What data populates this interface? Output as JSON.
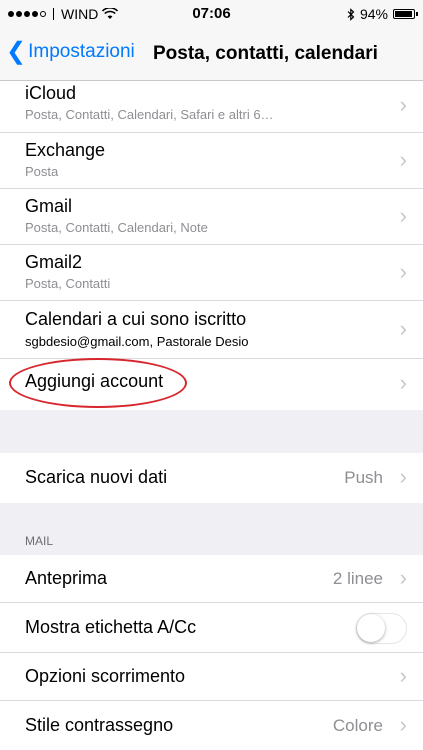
{
  "status_bar": {
    "carrier": "WIND",
    "time": "07:06",
    "battery_percent": "94%",
    "battery_level": 0.94
  },
  "nav": {
    "back_label": "Impostazioni",
    "title": "Posta, contatti, calendari"
  },
  "accounts": [
    {
      "title": "iCloud",
      "subtitle": "Posta, Contatti, Calendari, Safari e altri 6…"
    },
    {
      "title": "Exchange",
      "subtitle": "Posta"
    },
    {
      "title": "Gmail",
      "subtitle": "Posta, Contatti, Calendari, Note"
    },
    {
      "title": "Gmail2",
      "subtitle": "Posta, Contatti"
    },
    {
      "title": "Calendari a cui sono iscritto",
      "subtitle": "sgbdesio@gmail.com, Pastorale Desio"
    }
  ],
  "add_account": {
    "label": "Aggiungi account"
  },
  "fetch": {
    "label": "Scarica nuovi dati",
    "value": "Push"
  },
  "mail_section": {
    "header": "MAIL",
    "preview": {
      "label": "Anteprima",
      "value": "2 linee"
    },
    "show_to_cc": {
      "label": "Mostra etichetta A/Cc",
      "on": false
    },
    "swipe_options": {
      "label": "Opzioni scorrimento"
    },
    "flag_style": {
      "label": "Stile contrassegno",
      "value": "Colore"
    }
  }
}
